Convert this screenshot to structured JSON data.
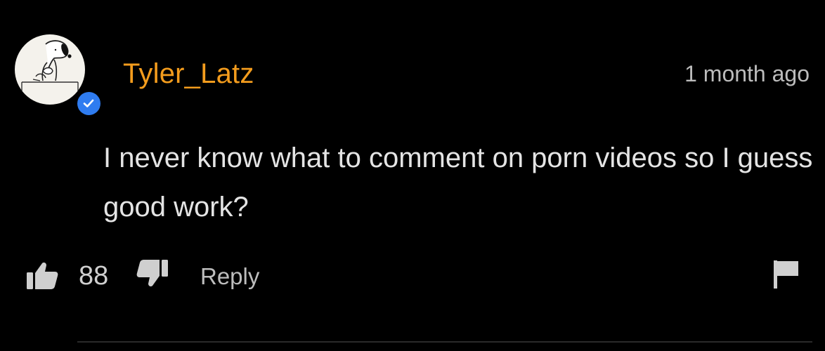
{
  "comment": {
    "username": "Tyler_Latz",
    "timestamp": "1 month ago",
    "verified": true,
    "text": "I never know what to comment on porn videos so I guess good work?",
    "likes": "88",
    "reply_label": "Reply"
  },
  "icons": {
    "avatar": "snoopy-avatar",
    "badge": "verified-check-icon",
    "like": "thumbs-up-icon",
    "dislike": "thumbs-down-icon",
    "report": "flag-icon"
  },
  "colors": {
    "background": "#000000",
    "username": "#f39c1d",
    "text": "#e4e4e4",
    "muted": "#bcbcbc",
    "verified": "#2f7cf0"
  }
}
